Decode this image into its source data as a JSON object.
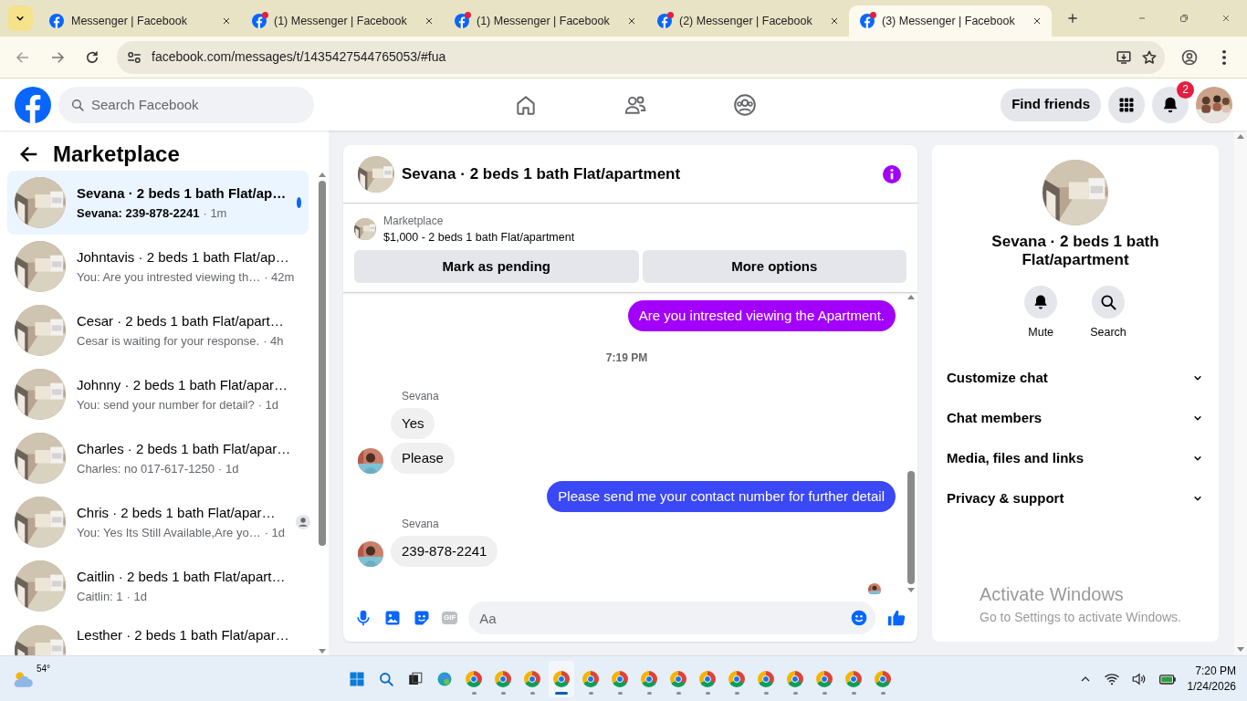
{
  "browser": {
    "tabs": [
      {
        "title": "Messenger | Facebook",
        "selected": false,
        "notify": false
      },
      {
        "title": "(1) Messenger | Facebook",
        "selected": false,
        "notify": true
      },
      {
        "title": "(1) Messenger | Facebook",
        "selected": false,
        "notify": true
      },
      {
        "title": "(2) Messenger | Facebook",
        "selected": false,
        "notify": true
      },
      {
        "title": "(3) Messenger | Facebook",
        "selected": true,
        "notify": true
      }
    ],
    "url": "facebook.com/messages/t/1435427544765053/#fua"
  },
  "header": {
    "search": {
      "placeholder": "Search Facebook"
    },
    "nav": [
      {
        "kind": "home"
      },
      {
        "kind": "friends"
      },
      {
        "kind": "groups"
      }
    ],
    "find_friends": "Find friends",
    "notifications_badge": "2"
  },
  "sidebar": {
    "title": "Marketplace",
    "conversations": [
      {
        "name": "Sevana · 2 beds 1 bath Flat/ap…",
        "preview": "Sevana: 239-878-2241",
        "time": "· 1m",
        "selected": true,
        "unread": true,
        "seen_receipt": false
      },
      {
        "name": "Johntavis · 2 beds 1 bath Flat/ap…",
        "preview": "You: Are you intrested viewing th…",
        "time": "· 42m",
        "selected": false,
        "unread": false,
        "seen_receipt": false
      },
      {
        "name": "Cesar · 2 beds 1 bath Flat/apart…",
        "preview": "Cesar is waiting for your response.",
        "time": "· 4h",
        "selected": false,
        "unread": false,
        "seen_receipt": false
      },
      {
        "name": "Johnny · 2 beds 1 bath Flat/apar…",
        "preview": "You: send your number for detail?",
        "time": "· 1d",
        "selected": false,
        "unread": false,
        "seen_receipt": false
      },
      {
        "name": "Charles · 2 beds 1 bath Flat/apar…",
        "preview": "Charles: no 017-617-1250",
        "time": "· 1d",
        "selected": false,
        "unread": false,
        "seen_receipt": false
      },
      {
        "name": "Chris · 2 beds 1 bath Flat/apar…",
        "preview": "You: Yes Its Still Available,Are yo…",
        "time": "· 1d",
        "selected": false,
        "unread": false,
        "seen_receipt": true
      },
      {
        "name": "Caitlin · 2 beds 1 bath Flat/apart…",
        "preview": "Caitlin: 1",
        "time": "· 1d",
        "selected": false,
        "unread": false,
        "seen_receipt": false
      },
      {
        "name": "Lesther · 2 beds 1 bath Flat/apar…",
        "selected": false,
        "unread": false,
        "seen_receipt": false
      }
    ]
  },
  "chat": {
    "title": "Sevana · 2 beds 1 bath Flat/apartment",
    "listing": {
      "label": "Marketplace",
      "price_line": "$1,000 - 2 beds 1 bath Flat/apartment",
      "actions": [
        "Mark as pending",
        "More options"
      ]
    },
    "messages": [
      {
        "kind": "outgoing",
        "text": "Are you intrested viewing the Apartment.",
        "color": "#a200fb"
      },
      {
        "kind": "timestamp",
        "text": "7:19 PM"
      },
      {
        "kind": "sender",
        "text": "Sevana"
      },
      {
        "kind": "incoming",
        "text": "Yes",
        "avatar": false
      },
      {
        "kind": "incoming",
        "text": "Please",
        "avatar": true
      },
      {
        "kind": "outgoing",
        "text": "Please send me your contact number for further detail",
        "color": "#3a48f6"
      },
      {
        "kind": "sender",
        "text": "Sevana"
      },
      {
        "kind": "incoming",
        "text": "239-878-2241",
        "avatar": true
      },
      {
        "kind": "seen"
      }
    ],
    "composer": {
      "gif_label": "GIF",
      "placeholder": "Aa"
    }
  },
  "details": {
    "title": "Sevana · 2 beds 1 bath Flat/apartment",
    "actions": [
      {
        "kind": "mute",
        "label": "Mute"
      },
      {
        "kind": "search",
        "label": "Search"
      }
    ],
    "sections": [
      {
        "label": "Customize chat",
        "expanded": false
      },
      {
        "label": "Chat members",
        "expanded": false
      },
      {
        "label": "Media, files and links",
        "expanded": false
      },
      {
        "label": "Privacy & support",
        "expanded": false
      }
    ]
  },
  "activation_notice": {
    "title": "Activate Windows",
    "text": "Go to Settings to activate Windows."
  },
  "taskbar": {
    "weather": "54°",
    "time": "7:20 PM",
    "date": "1/24/2026",
    "apps": [
      {
        "kind": "start",
        "selected": false
      },
      {
        "kind": "search",
        "selected": false
      },
      {
        "kind": "taskview",
        "selected": false
      },
      {
        "kind": "edge",
        "selected": false
      },
      {
        "kind": "chrome",
        "selected": false
      },
      {
        "kind": "chrome",
        "selected": false
      },
      {
        "kind": "chrome",
        "selected": false
      },
      {
        "kind": "chrome",
        "selected": true
      },
      {
        "kind": "chrome",
        "selected": false
      },
      {
        "kind": "chrome",
        "selected": false
      },
      {
        "kind": "chrome",
        "selected": false
      },
      {
        "kind": "chrome",
        "selected": false
      },
      {
        "kind": "chrome",
        "selected": false
      },
      {
        "kind": "chrome",
        "selected": false
      },
      {
        "kind": "chrome",
        "selected": false
      },
      {
        "kind": "chrome",
        "selected": false
      },
      {
        "kind": "chrome",
        "selected": false
      },
      {
        "kind": "chrome",
        "selected": false
      },
      {
        "kind": "chrome",
        "selected": false
      }
    ]
  }
}
